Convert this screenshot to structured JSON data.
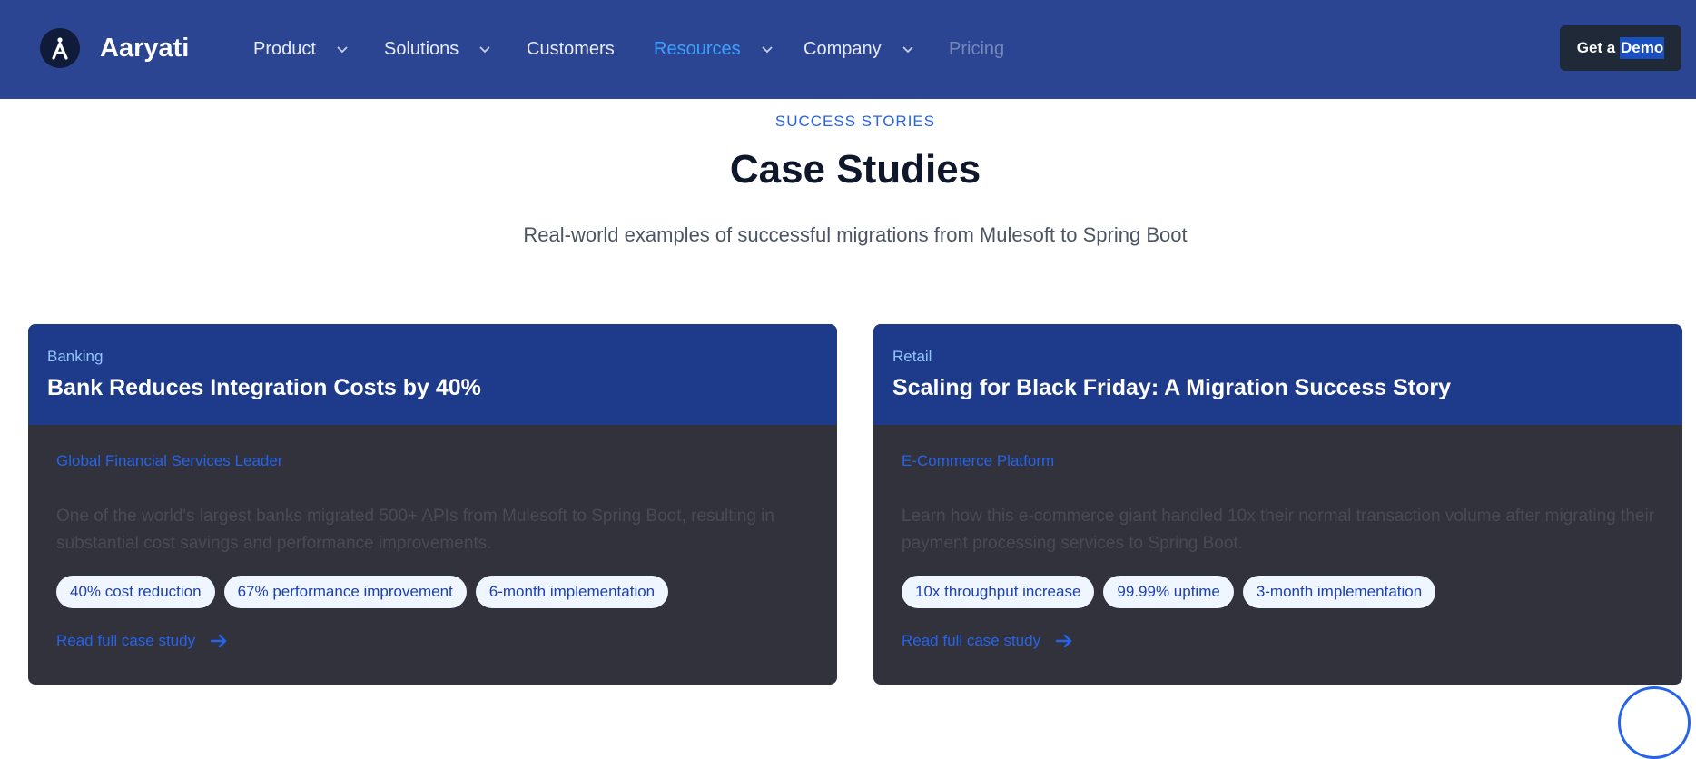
{
  "brand": {
    "name": "Aaryati",
    "logo_letter": "A"
  },
  "nav": {
    "items": [
      {
        "label": "Product"
      },
      {
        "label": "Solutions"
      },
      {
        "label": "Customers"
      },
      {
        "label": "Resources"
      },
      {
        "label": "Company"
      },
      {
        "label": "Pricing"
      }
    ],
    "active": "Resources",
    "cta": {
      "label_part1": "Get a ",
      "label_part2": "Demo"
    }
  },
  "hero": {
    "eyebrow": "SUCCESS STORIES",
    "title": "Case Studies",
    "subtitle": "Real-world examples of successful migrations from Mulesoft to Spring Boot"
  },
  "cases": [
    {
      "industry": "Banking",
      "title": "Bank Reduces Integration Costs by 40%",
      "client": "Global Financial Services Leader",
      "description": "One of the world's largest banks migrated 500+ APIs from Mulesoft to Spring Boot, resulting in substantial cost savings and performance improvements.",
      "metrics": [
        "40% cost reduction",
        "67% performance improvement",
        "6-month implementation"
      ],
      "link": "Read full case study"
    },
    {
      "industry": "Retail",
      "title": "Scaling for Black Friday: A Migration Success Story",
      "client": "E-Commerce Platform",
      "description": "Learn how this e-commerce giant handled 10x their normal transaction volume after migrating their payment processing services to Spring Boot.",
      "metrics": [
        "10x throughput increase",
        "99.99% uptime",
        "3-month implementation"
      ],
      "link": "Read full case study"
    }
  ],
  "colors": {
    "header_bg": "#2c4592",
    "card_head_bg": "#1e3a8a",
    "card_body_bg": "#32323d",
    "accent": "#2563eb",
    "active_nav": "#3aa0ff"
  }
}
